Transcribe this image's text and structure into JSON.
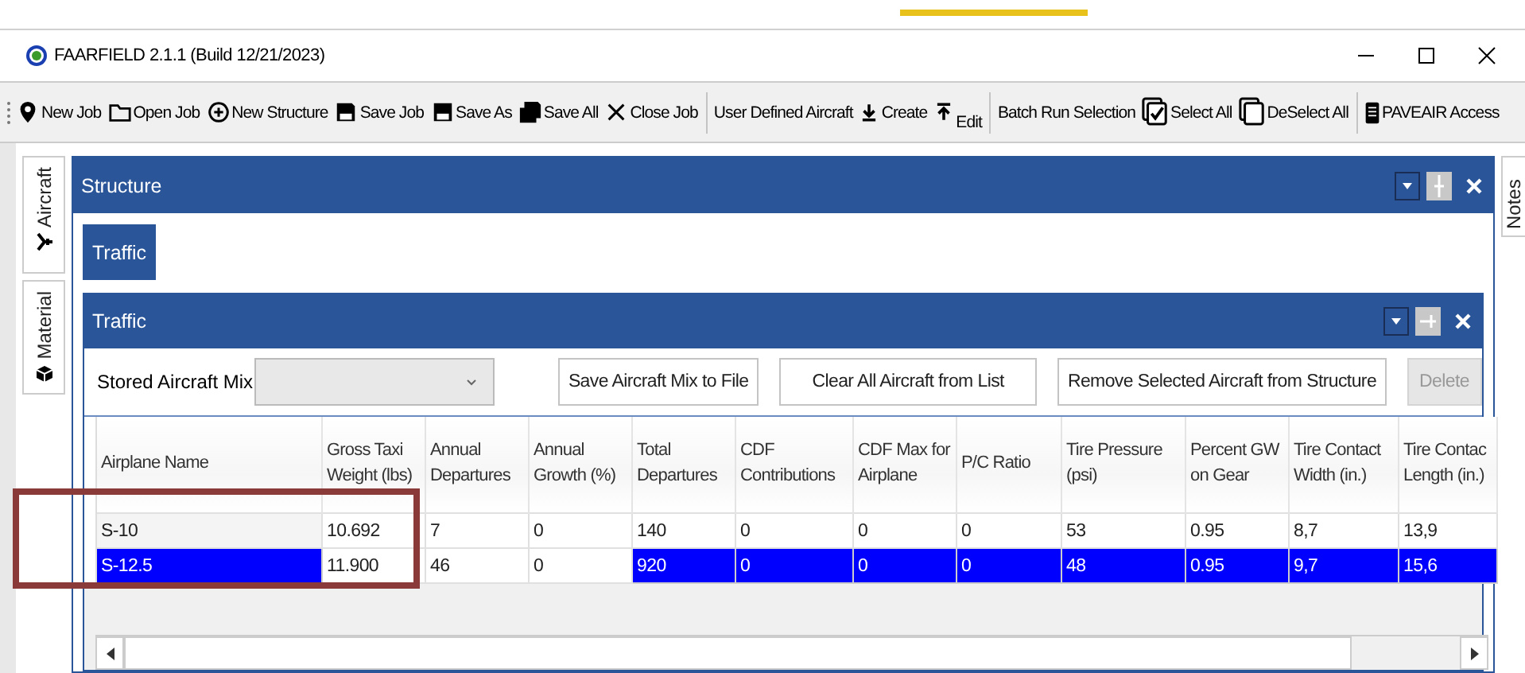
{
  "window": {
    "title": "FAARFIELD 2.1.1 (Build 12/21/2023)"
  },
  "toolbar_groups": [
    [
      {
        "label": "New Job"
      },
      {
        "label": "Open Job"
      },
      {
        "label": "New Structure"
      },
      {
        "label": "Save Job"
      },
      {
        "label": "Save As"
      },
      {
        "label": "Save All"
      },
      {
        "label": "Close Job"
      }
    ],
    [
      {
        "label": "User Defined Aircraft"
      },
      {
        "label": "Create"
      },
      {
        "label": "Edit"
      }
    ],
    [
      {
        "label": "Batch Run Selection"
      },
      {
        "label": "Select All"
      },
      {
        "label": "DeSelect All"
      }
    ],
    [
      {
        "label": "PAVEAIR Access"
      }
    ]
  ],
  "side_tabs": [
    {
      "label": "Aircraft"
    },
    {
      "label": "Material"
    }
  ],
  "right_tabs": [
    {
      "label": "Notes"
    }
  ],
  "structure_panel": {
    "title": "Structure",
    "tabs": [
      {
        "label": "Traffic",
        "selected": true
      }
    ],
    "traffic_panel": {
      "title": "Traffic",
      "stored_mix_label": "Stored Aircraft Mix",
      "buttons": [
        {
          "label": "Save Aircraft Mix to File",
          "disabled": false
        },
        {
          "label": "Clear All Aircraft from List",
          "disabled": false
        },
        {
          "label": "Remove Selected Aircraft from Structure",
          "disabled": false
        },
        {
          "label": "Delete",
          "disabled": true
        }
      ],
      "table": {
        "columns": [
          {
            "label": "Airplane Name",
            "editable": false
          },
          {
            "label": "Gross Taxi Weight (lbs)",
            "editable": true
          },
          {
            "label": "Annual Departures",
            "editable": true
          },
          {
            "label": "Annual Growth (%)",
            "editable": true
          },
          {
            "label": "Total Departures",
            "editable": false
          },
          {
            "label": "CDF Contributions",
            "editable": false
          },
          {
            "label": "CDF Max for Airplane",
            "editable": false
          },
          {
            "label": "P/C Ratio",
            "editable": false
          },
          {
            "label": "Tire Pressure (psi)",
            "editable": false
          },
          {
            "label": "Percent GW on Gear",
            "editable": false
          },
          {
            "label": "Tire Contact Width (in.)",
            "editable": false
          },
          {
            "label": "Tire Contac Length (in.)",
            "editable": false
          }
        ],
        "rows": [
          {
            "selected": false,
            "cells": [
              "S-10",
              "10.692",
              "7",
              "0",
              "140",
              "0",
              "0",
              "0",
              "53",
              "0.95",
              "8,7",
              "13,9"
            ]
          },
          {
            "selected": true,
            "cells": [
              "S-12.5",
              "11.900",
              "46",
              "0",
              "920",
              "0",
              "0",
              "0",
              "48",
              "0.95",
              "9,7",
              "15,6"
            ]
          }
        ]
      }
    }
  }
}
